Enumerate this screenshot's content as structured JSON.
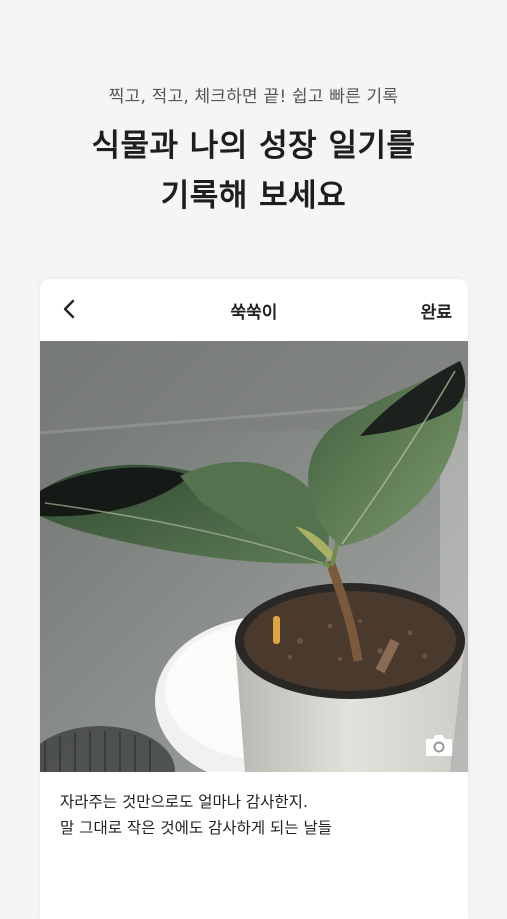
{
  "promo": {
    "subtitle": "찍고, 적고, 체크하면 끝! 쉽고 빠른 기록",
    "title_line1": "식물과 나의 성장 일기를",
    "title_line2": "기록해 보세요"
  },
  "header": {
    "title": "쑥쑥이",
    "done_label": "완료",
    "back_icon": "chevron-left-icon"
  },
  "photo": {
    "camera_icon": "camera-icon"
  },
  "caption": {
    "line1": "자라주는 것만으로도 얼마나 감사한지.",
    "line2": "말 그대로 작은 것에도 감사하게 되는 날들"
  },
  "colors": {
    "background": "#f5f5f5",
    "card": "#ffffff",
    "text_dark": "#1e1e1e",
    "text_sub": "#555555"
  }
}
